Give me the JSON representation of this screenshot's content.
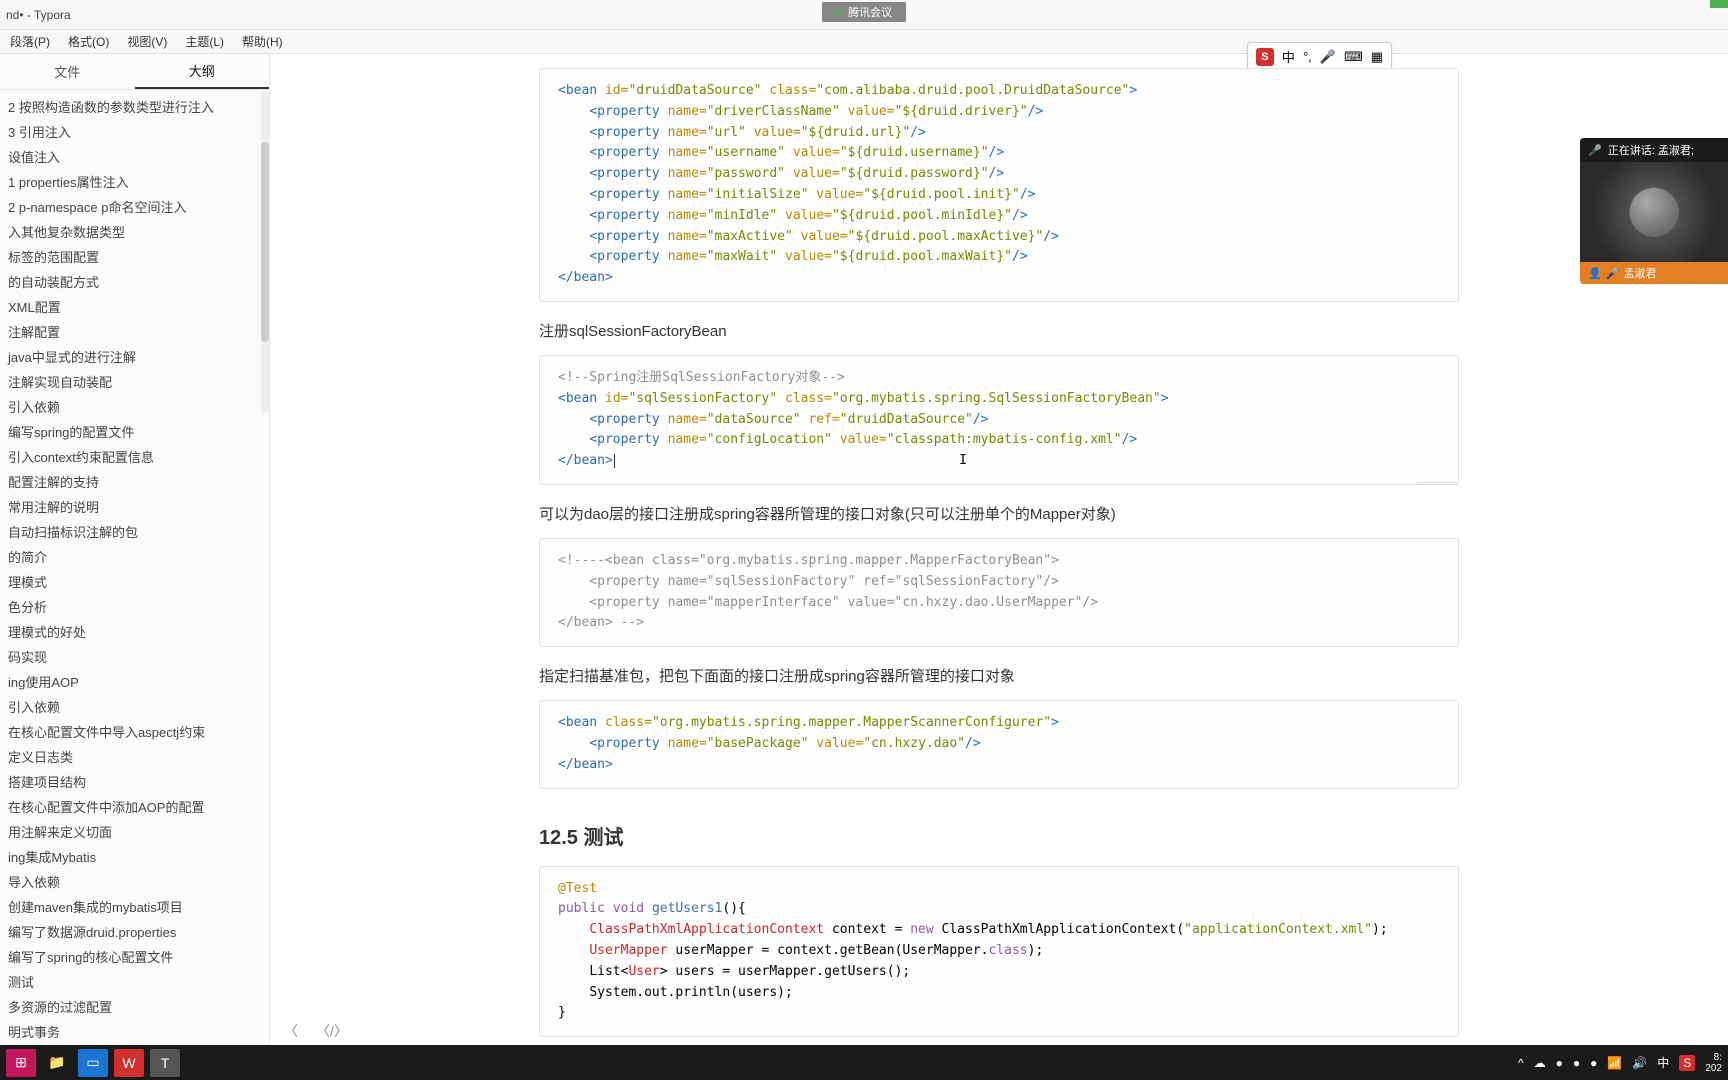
{
  "titlebar": {
    "title": "nd• - Typora"
  },
  "menubar": {
    "para": "段落(P)",
    "format": "格式(O)",
    "view": "视图(V)",
    "theme": "主题(L)",
    "help": "帮助(H)"
  },
  "sidetabs": {
    "files": "文件",
    "outline": "大纲"
  },
  "outline": [
    "2 按照构造函数的参数类型进行注入",
    "3 引用注入",
    "设值注入",
    "1 properties属性注入",
    "2 p-namespace p命名空间注入",
    "入其他复杂数据类型",
    "标签的范围配置",
    "的自动装配方式",
    "XML配置",
    "注解配置",
    "java中显式的进行注解",
    "注解实现自动装配",
    "引入依赖",
    "编写spring的配置文件",
    "引入context约束配置信息",
    "配置注解的支持",
    "常用注解的说明",
    "自动扫描标识注解的包",
    "的简介",
    "理模式",
    "色分析",
    "理模式的好处",
    "码实现",
    "ing使用AOP",
    "引入依赖",
    "在核心配置文件中导入aspectj约束",
    "定义日志类",
    "搭建项目结构",
    "在核心配置文件中添加AOP的配置",
    "用注解来定义切面",
    "ing集成Mybatis",
    "导入依赖",
    "创建maven集成的mybatis项目",
    "编写了数据源druid.properties",
    "编写了spring的核心配置文件",
    "测试",
    "多资源的过滤配置",
    "明式事务"
  ],
  "para1": "注册sqlSessionFactoryBean",
  "para2": "可以为dao层的接口注册成spring容器所管理的接口对象(只可以注册单个的Mapper对象)",
  "para3": "指定扫描基准包，把包下面面的接口注册成spring容器所管理的接口对象",
  "heading": "12.5 测试",
  "codeLang": "xml",
  "code1": {
    "l1_open": "<bean",
    "l1_id": " id=",
    "l1_idv": "\"druidDataSource\"",
    "l1_cls": " class=",
    "l1_clsv": "\"com.alibaba.druid.pool.DruidDataSource\"",
    "l1_end": ">",
    "p_open": "<property",
    "p_name": " name=",
    "p_val": " value=",
    "p_end": "/>",
    "n1": "\"driverClassName\"",
    "v1": "\"${druid.driver}\"",
    "n2": "\"url\"",
    "v2": "\"${druid.url}\"",
    "n3": "\"username\"",
    "v3": "\"${druid.username}\"",
    "n4": "\"password\"",
    "v4": "\"${druid.password}\"",
    "n5": "\"initialSize\"",
    "v5": "\"${druid.pool.init}\"",
    "n6": "\"minIdle\"",
    "v6": "\"${druid.pool.minIdle}\"",
    "n7": "\"maxActive\"",
    "v7": "\"${druid.pool.maxActive}\"",
    "n8": "\"maxWait\"",
    "v8": "\"${druid.pool.maxWait}\"",
    "close": "</bean>"
  },
  "code2": {
    "c1": "<!--Spring注册SqlSessionFactory对象-->",
    "open": "<bean",
    "id": " id=",
    "idv": "\"sqlSessionFactory\"",
    "cls": " class=",
    "clsv": "\"org.mybatis.spring.SqlSessionFactoryBean\"",
    "end": ">",
    "p_open": "<property",
    "p_name": " name=",
    "p_ref": " ref=",
    "p_val": " value=",
    "p_end": "/>",
    "n1": "\"dataSource\"",
    "r1": "\"druidDataSource\"",
    "n2": "\"configLocation\"",
    "v2": "\"classpath:mybatis-config.xml\"",
    "close": "</bean>"
  },
  "code3": {
    "l1": "<!----<bean class=\"org.mybatis.spring.mapper.MapperFactoryBean\">",
    "l2": "    <property name=\"sqlSessionFactory\" ref=\"sqlSessionFactory\"/>",
    "l3": "    <property name=\"mapperInterface\" value=\"cn.hxzy.dao.UserMapper\"/>",
    "l4": "</bean> -->"
  },
  "code4": {
    "open": "<bean",
    "cls": " class=",
    "clsv": "\"org.mybatis.spring.mapper.MapperScannerConfigurer\"",
    "end": ">",
    "p_open": "<property",
    "p_name": " name=",
    "p_val": " value=",
    "p_end": "/>",
    "n1": "\"basePackage\"",
    "v1": "\"cn.hxzy.dao\"",
    "close": "</bean>"
  },
  "code5": {
    "ann": "@Test",
    "pub": "public",
    "void": "void",
    "fn": "getUsers1",
    "paren": "(){",
    "type1": "ClassPathXmlApplicationContext",
    "var1": " context = ",
    "new": "new",
    "ctor": " ClassPathXmlApplicationContext(",
    "str1": "\"applicationContext.xml\"",
    "end1": ");",
    "type2": "UserMapper",
    "var2": " userMapper = context.getBean(UserMapper.",
    "kw2": "class",
    "end2": ");",
    "l4a": "List<",
    "l4t": "User",
    "l4b": "> users = userMapper.getUsers();",
    "l5a": "System.out.println(users);",
    "close": "}"
  },
  "meeting": {
    "label": "腾讯会议"
  },
  "overlay": {
    "speaking": "正在讲话: 孟淑君;",
    "name": "孟淑君"
  },
  "ime": {
    "zh": "中",
    "comma": "°,"
  },
  "tray": {
    "zh": "中",
    "time1": "8:",
    "time2": "202"
  }
}
